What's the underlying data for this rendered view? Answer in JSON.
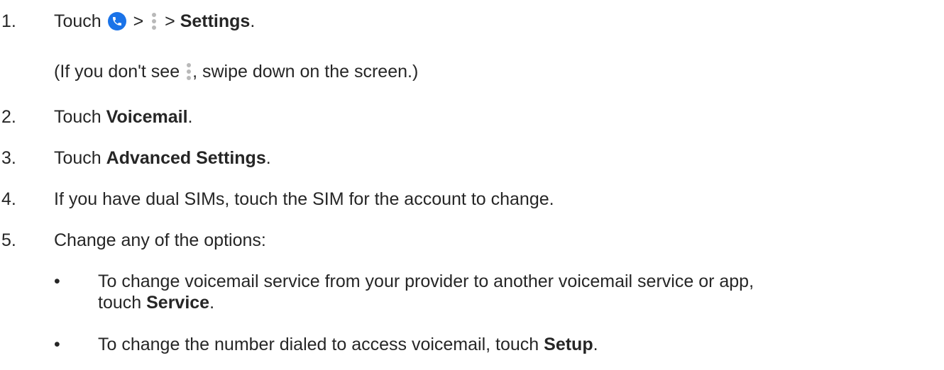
{
  "steps": [
    {
      "num": "1.",
      "touch": "Touch",
      "gt1": ">",
      "gt2": ">",
      "bold": "Settings",
      "end": ".",
      "icons": [
        "phone-icon",
        "more-vert-icon"
      ]
    },
    {
      "note_prefix": "(If you don't see",
      "note_suffix": ", swipe down on the screen.)",
      "icon": "more-vert-icon"
    },
    {
      "num": "2.",
      "text": "Touch ",
      "bold": "Voicemail",
      "end": "."
    },
    {
      "num": "3.",
      "text": "Touch ",
      "bold": "Advanced Settings",
      "end": "."
    },
    {
      "num": "4.",
      "text": "If you have dual SIMs, touch the SIM for the account to change."
    },
    {
      "num": "5.",
      "text": "Change any of the options:"
    }
  ],
  "bullets": [
    {
      "mark": "•",
      "line1": "To change voicemail service from your provider to another voicemail service or app,",
      "line2_prefix": "touch ",
      "bold": "Service",
      "end": "."
    },
    {
      "mark": "•",
      "text": "To change the number dialed to access voicemail, touch ",
      "bold": "Setup",
      "end": "."
    }
  ],
  "colors": {
    "text": "#262626",
    "phone_icon_bg": "#1a73e8",
    "dots": "#b9b9b9"
  }
}
